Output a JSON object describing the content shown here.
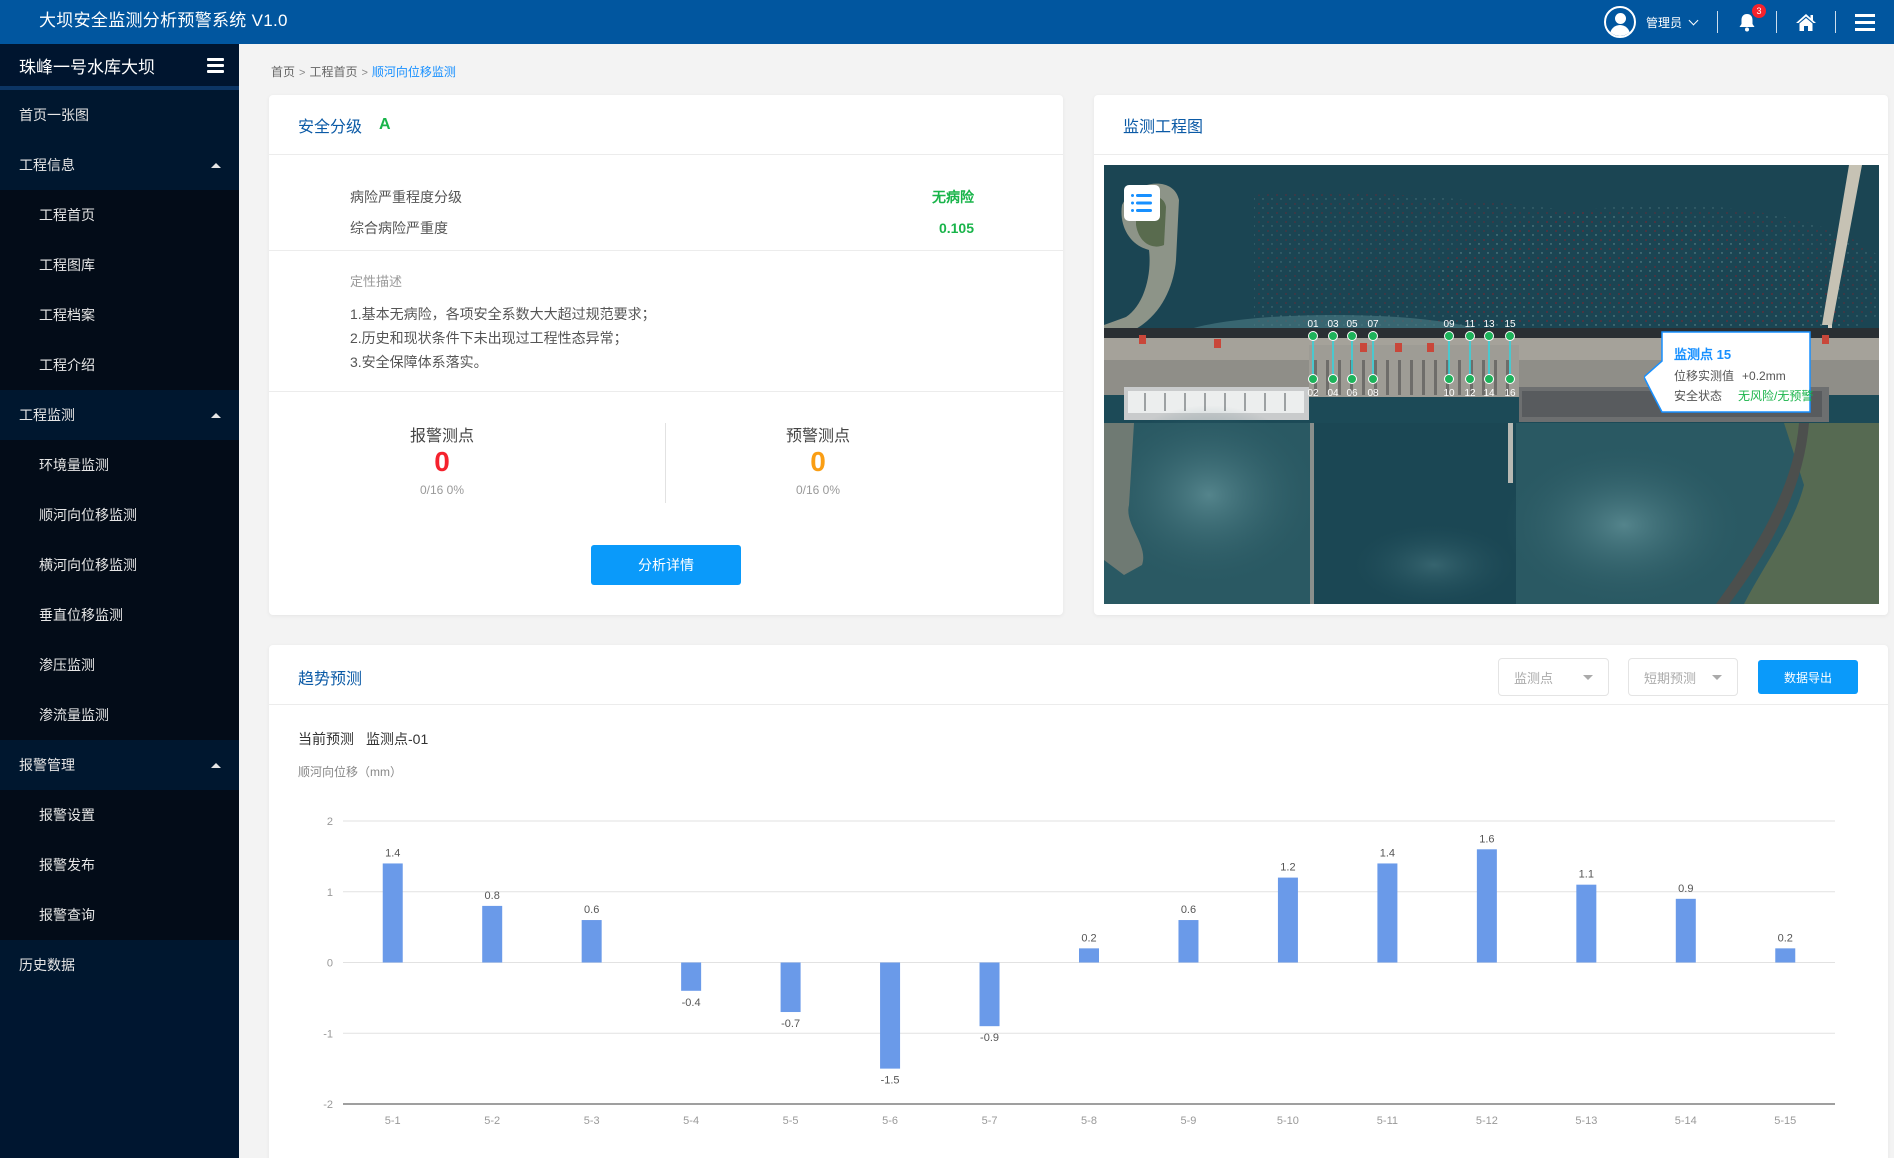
{
  "app": {
    "title": "大坝安全监测分析预警系统 V1.0",
    "user_name": "管理员",
    "notification_count": "3",
    "icons": [
      "user-avatar-icon",
      "chevron-down-icon",
      "bell-icon",
      "home-icon",
      "menu-icon"
    ]
  },
  "sidebar": {
    "project_name": "珠峰一号水库大坝",
    "items": [
      {
        "label": "首页一张图",
        "type": "top"
      },
      {
        "label": "工程信息",
        "type": "group",
        "expanded": true,
        "children": [
          "工程首页",
          "工程图库",
          "工程档案",
          "工程介绍"
        ]
      },
      {
        "label": "工程监测",
        "type": "group",
        "expanded": true,
        "children": [
          "环境量监测",
          "顺河向位移监测",
          "横河向位移监测",
          "垂直位移监测",
          "渗压监测",
          "渗流量监测"
        ]
      },
      {
        "label": "报警管理",
        "type": "group",
        "expanded": true,
        "children": [
          "报警设置",
          "报警发布",
          "报警查询"
        ]
      },
      {
        "label": "历史数据",
        "type": "top"
      }
    ]
  },
  "breadcrumb": {
    "items": [
      "首页",
      "工程首页"
    ],
    "current": "顺河向位移监测",
    "separator": ">"
  },
  "safety": {
    "title": "安全分级",
    "grade": "A",
    "rows": [
      {
        "label": "病险严重程度分级",
        "value": "无病险"
      },
      {
        "label": "综合病险严重度",
        "value": "0.105"
      }
    ],
    "description_title": "定性描述",
    "description": [
      "1.基本无病险，各项安全系数大大超过规范要求；",
      "2.历史和现状条件下未出现过工程性态异常；",
      "3.安全保障体系落实。"
    ],
    "alarm": {
      "label": "报警测点",
      "count": "0",
      "detail": "0/16  0%"
    },
    "warning": {
      "label": "预警测点",
      "count": "0",
      "detail": "0/16  0%"
    },
    "button_label": "分析详情",
    "colors": {
      "good": "#19b44a",
      "alarm": "#f5222d",
      "warning": "#fa9e14"
    }
  },
  "map": {
    "title": "监测工程图",
    "points_top": [
      "01",
      "03",
      "05",
      "07",
      "09",
      "11",
      "13",
      "15"
    ],
    "points_bottom": [
      "02",
      "04",
      "06",
      "08",
      "10",
      "12",
      "14",
      "16"
    ],
    "point_color": "#1db35a",
    "tooltip": {
      "title": "监测点 15",
      "value_label": "位移实测值",
      "value": "+0.2mm",
      "status_label": "安全状态",
      "status": "无风险/无预警"
    }
  },
  "trend": {
    "title": "趋势预测",
    "select_point_placeholder": "监测点",
    "select_period_placeholder": "短期预测",
    "export_label": "数据导出",
    "current_label": "当前预测",
    "current_point": "监测点-01"
  },
  "chart_data": {
    "type": "bar",
    "title": "",
    "ylabel": "顺河向位移（mm）",
    "xlabel": "",
    "categories": [
      "5-1",
      "5-2",
      "5-3",
      "5-4",
      "5-5",
      "5-6",
      "5-7",
      "5-8",
      "5-9",
      "5-10",
      "5-11",
      "5-12",
      "5-13",
      "5-14",
      "5-15"
    ],
    "values": [
      1.4,
      0.8,
      0.6,
      -0.4,
      -0.7,
      -1.5,
      -0.9,
      0.2,
      0.6,
      1.2,
      1.4,
      1.6,
      1.1,
      0.9,
      0.2
    ],
    "ylim": [
      -2,
      2
    ],
    "yticks": [
      2,
      1,
      0,
      -1,
      -2
    ],
    "grid": true,
    "data_labels": true,
    "bar_color": "#6a9ae9",
    "legend": "none"
  }
}
